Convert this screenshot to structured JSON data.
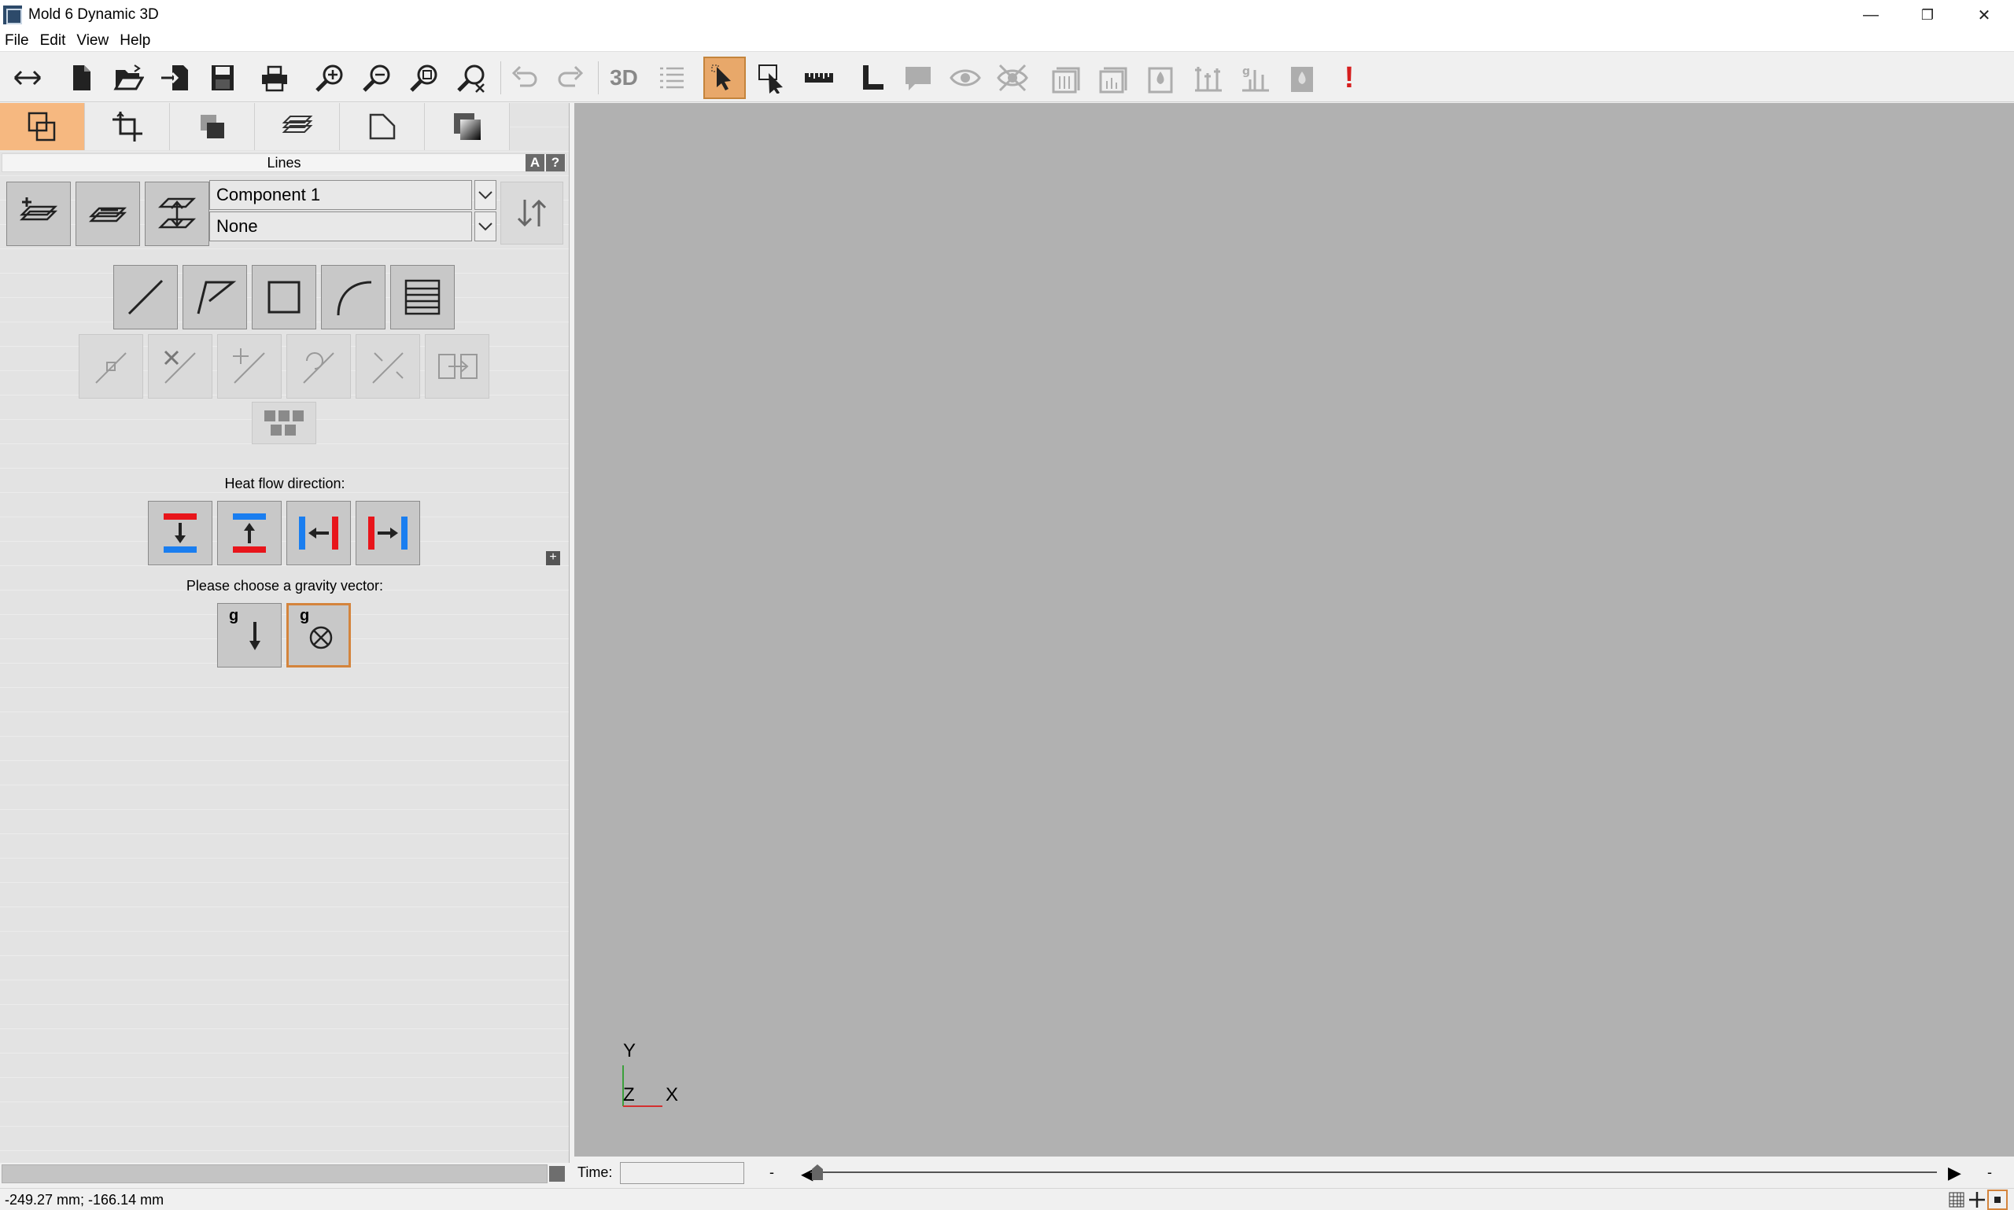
{
  "window": {
    "title": "Mold 6 Dynamic 3D",
    "minimize": "—",
    "restore": "❐",
    "close": "✕"
  },
  "menu": [
    "File",
    "Edit",
    "View",
    "Help"
  ],
  "toolbar": {
    "items": [
      {
        "name": "swap-icon"
      },
      {
        "name": "new-file-icon"
      },
      {
        "name": "open-folder-icon"
      },
      {
        "name": "import-icon"
      },
      {
        "name": "save-icon"
      },
      {
        "name": "print-icon"
      },
      {
        "name": "zoom-in-icon"
      },
      {
        "name": "zoom-out-icon"
      },
      {
        "name": "zoom-fit-icon"
      },
      {
        "name": "zoom-reset-icon"
      },
      {
        "name": "undo-icon",
        "disabled": true
      },
      {
        "name": "redo-icon",
        "disabled": true
      },
      {
        "name": "3d-view-icon",
        "label": "3D",
        "disabled": true
      },
      {
        "name": "list-icon",
        "disabled": true
      },
      {
        "name": "select-pointer-icon",
        "active": true
      },
      {
        "name": "select-box-icon"
      },
      {
        "name": "ruler-icon"
      },
      {
        "name": "dimension-icon"
      },
      {
        "name": "comment-icon",
        "disabled": true
      },
      {
        "name": "eye-icon",
        "disabled": true
      },
      {
        "name": "hide-icon",
        "disabled": true
      },
      {
        "name": "result-1-icon",
        "disabled": true
      },
      {
        "name": "result-2-icon",
        "disabled": true
      },
      {
        "name": "result-3-icon",
        "disabled": true
      },
      {
        "name": "result-4-icon",
        "disabled": true
      },
      {
        "name": "result-5-icon",
        "disabled": true
      },
      {
        "name": "result-6-icon",
        "disabled": true
      },
      {
        "name": "alert-icon",
        "label": "!"
      }
    ]
  },
  "panel": {
    "tabs": [
      {
        "name": "tab-geometry"
      },
      {
        "name": "tab-crop"
      },
      {
        "name": "tab-layers"
      },
      {
        "name": "tab-stack"
      },
      {
        "name": "tab-page"
      },
      {
        "name": "tab-gradient"
      }
    ],
    "header": "Lines",
    "header_btn_a": "A",
    "header_btn_help": "?",
    "component_select": "Component 1",
    "secondary_select": "None",
    "heat_flow_label": "Heat flow direction:",
    "gravity_label": "Please choose a gravity vector:",
    "gravity_down_label": "g",
    "gravity_into_label": "g",
    "expand_label": "+"
  },
  "viewport": {
    "axis_y": "Y",
    "axis_z": "Z",
    "axis_x": "X"
  },
  "timebar": {
    "label": "Time:",
    "value": "",
    "dash_left": "-",
    "dash_right": "-"
  },
  "status": {
    "coords": "-249.27 mm; -166.14 mm"
  },
  "colors": {
    "accent": "#e8a86a",
    "heat_red": "#e8151b",
    "heat_blue": "#1a7ef0",
    "viewport": "#b1b1b1"
  }
}
